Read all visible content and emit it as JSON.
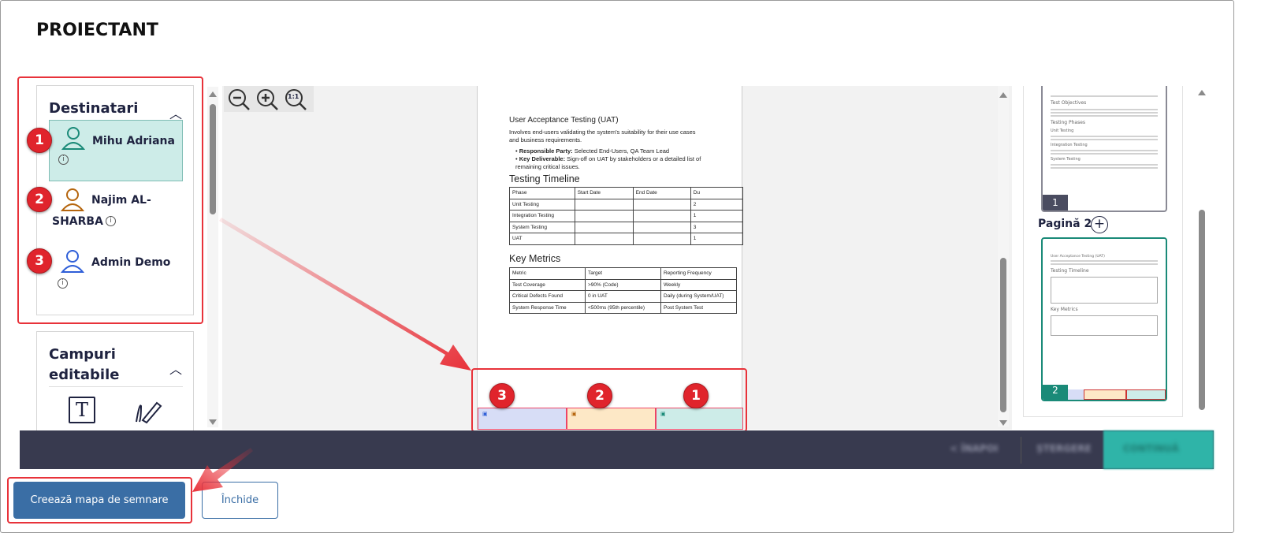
{
  "dialog": {
    "title": "PROIECTANT"
  },
  "recipients": {
    "title": "Destinatari",
    "items": [
      {
        "number": "1",
        "name": "Mihu Adriana",
        "color": "#1a8a78"
      },
      {
        "number": "2",
        "name_line1": "Najim AL-",
        "name_line2": "SHARBA",
        "color": "#b5650d"
      },
      {
        "number": "3",
        "name": "Admin Demo",
        "color": "#2f5fd8"
      }
    ]
  },
  "editable_fields": {
    "title_line1": "Campuri",
    "title_line2": "editabile"
  },
  "zoom": {
    "zoom_out": "zoom-out",
    "zoom_in": "zoom-in",
    "actual_size": "1:1"
  },
  "document": {
    "uat_heading": "User Acceptance Testing (UAT)",
    "uat_desc": "Involves end-users validating the system's suitability for their use cases and business requirements.",
    "bullet1_label": "Responsible Party:",
    "bullet1_text": " Selected End-Users, QA Team Lead",
    "bullet2_label": "Key Deliverable:",
    "bullet2_text": " Sign-off on UAT by stakeholders or a detailed list of remaining critical issues.",
    "timeline_heading": "Testing Timeline",
    "timeline_rows": [
      [
        "Phase",
        "Start Date",
        "End Date",
        "Du"
      ],
      [
        "Unit Testing",
        "",
        "",
        "2"
      ],
      [
        "Integration Testing",
        "",
        "",
        "1"
      ],
      [
        "System Testing",
        "",
        "",
        "3"
      ],
      [
        "UAT",
        "",
        "",
        "1"
      ]
    ],
    "metrics_heading": "Key Metrics",
    "metrics_rows": [
      [
        "Metric",
        "Target",
        "Reporting Frequency"
      ],
      [
        "Test Coverage",
        ">90% (Code)",
        "Weekly"
      ],
      [
        "Critical Defects Found",
        "0 in UAT",
        "Daily (during System/UAT)"
      ],
      [
        "System Response Time",
        "<500ms (95th percentile)",
        "Post System Test"
      ]
    ]
  },
  "signature_fields": [
    {
      "number": "3",
      "color": "#d7ddf6"
    },
    {
      "number": "2",
      "color": "#fde8c6"
    },
    {
      "number": "1",
      "color": "#cdece8"
    }
  ],
  "thumbnails": {
    "page1_number": "1",
    "page1_headings": [
      "Test Objectives",
      "Testing Phases",
      "Unit Testing",
      "Integration Testing",
      "System Testing"
    ],
    "page2_label": "Pagină 2",
    "page2_number": "2"
  },
  "toolbar": {
    "back": "< ÎNAPOI",
    "delete": "ȘTERGERE",
    "next": "CONTINUĂ"
  },
  "footer": {
    "create_button": "Creează mapa de semnare",
    "close_button": "Închide"
  }
}
